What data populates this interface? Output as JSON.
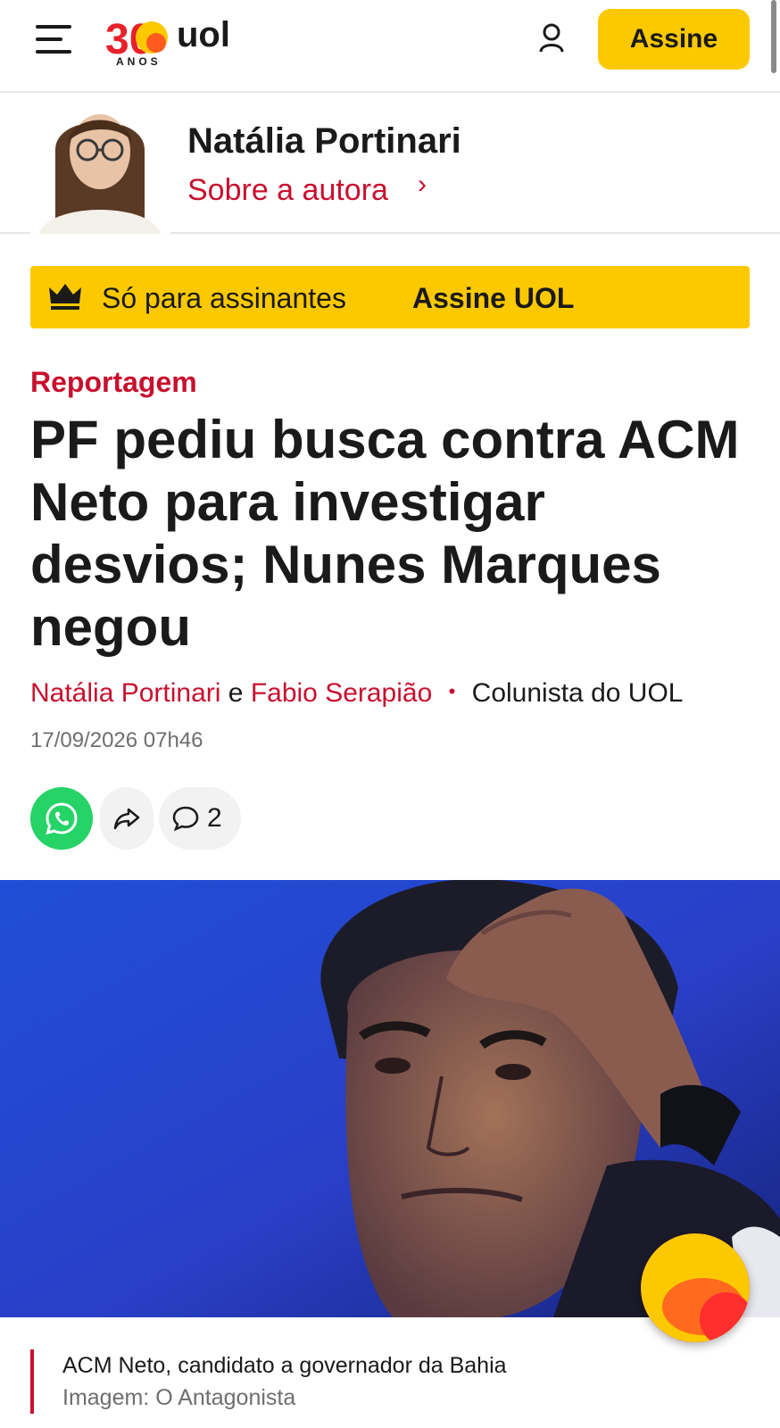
{
  "header": {
    "logo_number": "30",
    "logo_brand": "uol",
    "logo_anos": "ANOS",
    "subscribe_label": "Assine",
    "colors": {
      "brand_yellow": "#fcc900",
      "brand_red": "#c8102e"
    }
  },
  "author_card": {
    "name": "Natália Portinari",
    "about_link": "Sobre a autora",
    "chevron": "›"
  },
  "subscribers_banner": {
    "icon": "crown-icon",
    "text": "Só para assinantes",
    "cta": "Assine UOL"
  },
  "article": {
    "kicker": "Reportagem",
    "headline": "PF pediu busca contra ACM Neto para investigar desvios; Nunes Marques negou",
    "authors": [
      "Natália Portinari",
      "Fabio Serapião"
    ],
    "author_joiner": "e",
    "author_separator": "•",
    "role": "Colunista do UOL",
    "date": "17/09/2026 07h46"
  },
  "share": {
    "whatsapp_icon": "whatsapp-icon",
    "share_icon": "share-arrow-icon",
    "comment_icon": "comment-icon",
    "comment_count": "2"
  },
  "image": {
    "caption": "ACM Neto, candidato a governador da Bahia",
    "credit": "Imagem: O Antagonista"
  }
}
